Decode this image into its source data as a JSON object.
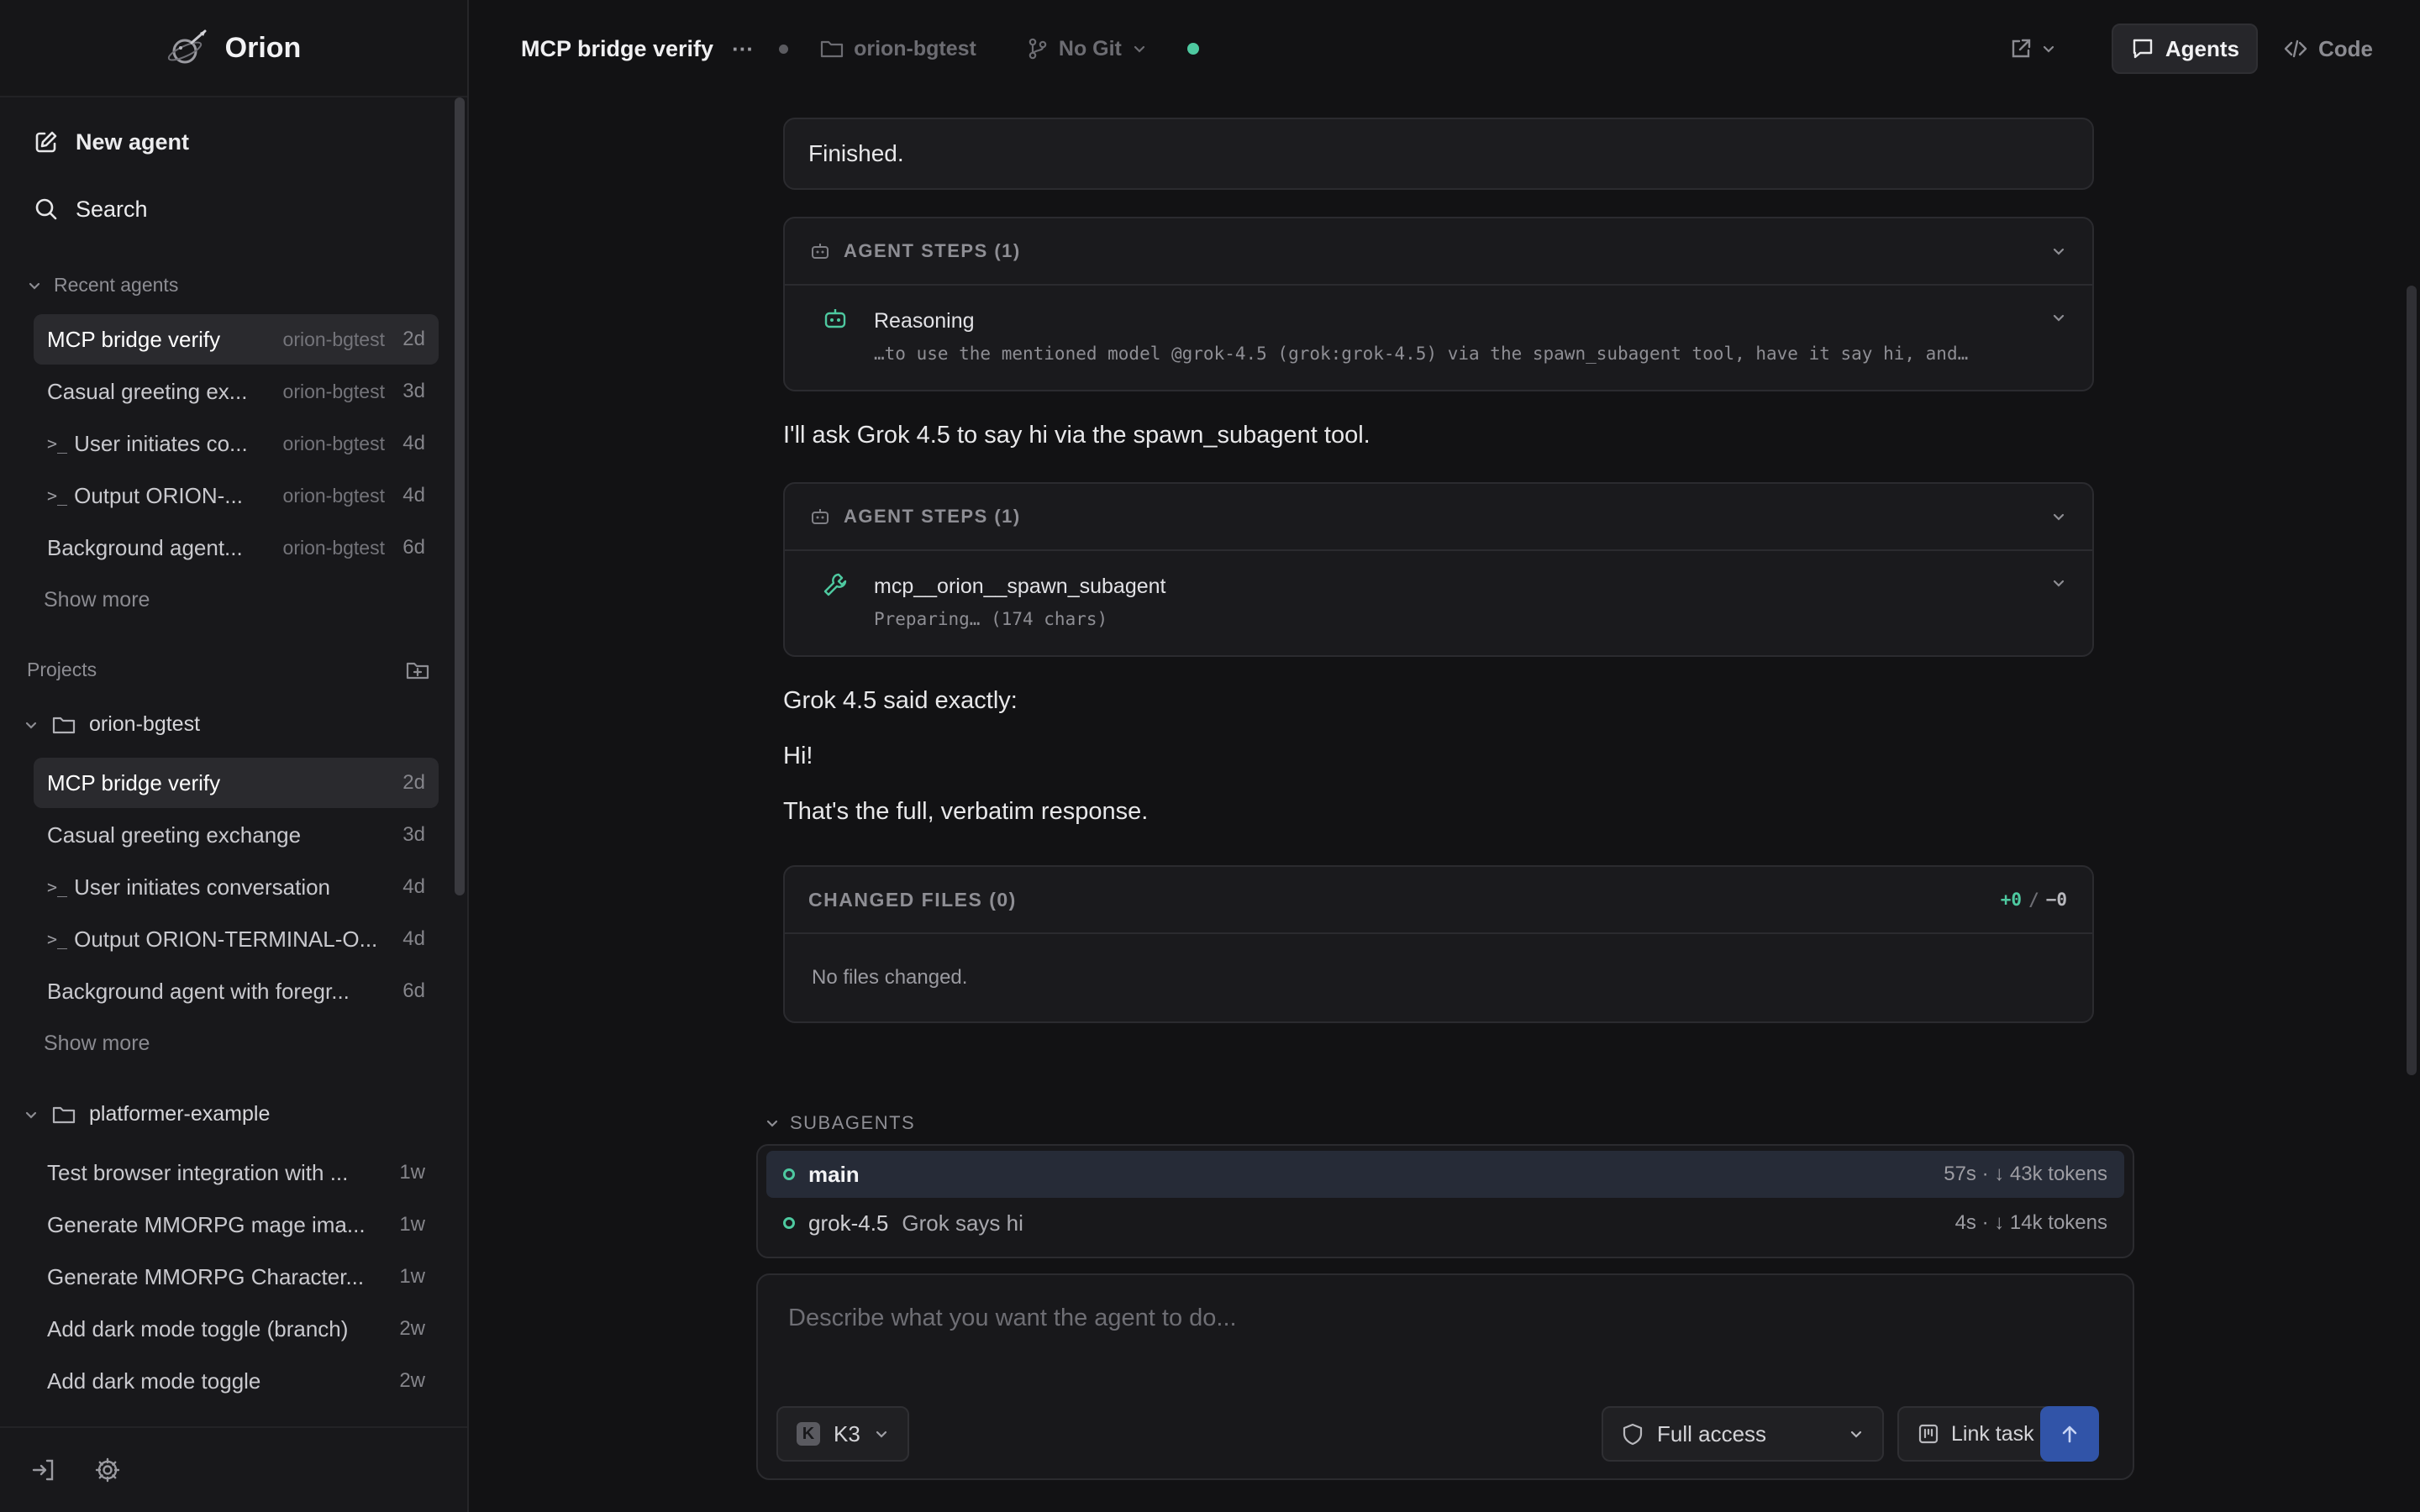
{
  "app": {
    "name": "Orion"
  },
  "sidebar": {
    "new_agent": "New agent",
    "search": "Search",
    "recent_heading": "Recent agents",
    "recent": [
      {
        "title": "MCP bridge verify",
        "project": "orion-bgtest",
        "age": "2d",
        "active": true,
        "terminal": false
      },
      {
        "title": "Casual greeting ex...",
        "project": "orion-bgtest",
        "age": "3d",
        "active": false,
        "terminal": false
      },
      {
        "title": "User initiates co...",
        "project": "orion-bgtest",
        "age": "4d",
        "active": false,
        "terminal": true
      },
      {
        "title": "Output ORION-...",
        "project": "orion-bgtest",
        "age": "4d",
        "active": false,
        "terminal": true
      },
      {
        "title": "Background agent...",
        "project": "orion-bgtest",
        "age": "6d",
        "active": false,
        "terminal": false
      }
    ],
    "show_more": "Show more",
    "projects_heading": "Projects",
    "projects": [
      {
        "name": "orion-bgtest",
        "items": [
          {
            "title": "MCP bridge verify",
            "age": "2d",
            "active": true,
            "terminal": false
          },
          {
            "title": "Casual greeting exchange",
            "age": "3d",
            "active": false,
            "terminal": false
          },
          {
            "title": "User initiates conversation",
            "age": "4d",
            "active": false,
            "terminal": true
          },
          {
            "title": "Output ORION-TERMINAL-O...",
            "age": "4d",
            "active": false,
            "terminal": true
          },
          {
            "title": "Background agent with foregr...",
            "age": "6d",
            "active": false,
            "terminal": false
          }
        ],
        "show_more": "Show more"
      },
      {
        "name": "platformer-example",
        "items": [
          {
            "title": "Test browser integration with ...",
            "age": "1w",
            "active": false,
            "terminal": false
          },
          {
            "title": "Generate MMORPG mage ima...",
            "age": "1w",
            "active": false,
            "terminal": false
          },
          {
            "title": "Generate MMORPG Character...",
            "age": "1w",
            "active": false,
            "terminal": false
          },
          {
            "title": "Add dark mode toggle (branch)",
            "age": "2w",
            "active": false,
            "terminal": false
          },
          {
            "title": "Add dark mode toggle",
            "age": "2w",
            "active": false,
            "terminal": false
          }
        ]
      }
    ]
  },
  "topbar": {
    "title": "MCP bridge verify",
    "more": "···",
    "project": "orion-bgtest",
    "git": "No Git",
    "tabs": {
      "agents": "Agents",
      "code": "Code"
    }
  },
  "chat": {
    "finished": "Finished.",
    "steps_1": {
      "heading": "AGENT STEPS (1)",
      "name": "Reasoning",
      "detail": "…to use the mentioned model @grok-4.5 (grok:grok-4.5) via the spawn_subagent tool, have it say hi, and…"
    },
    "msg_1": "I'll ask Grok 4.5 to say hi via the spawn_subagent tool.",
    "steps_2": {
      "heading": "AGENT STEPS (1)",
      "name": "mcp__orion__spawn_subagent",
      "detail": "Preparing… (174 chars)"
    },
    "msg_2": "Grok 4.5 said exactly:",
    "msg_3": "Hi!",
    "msg_4": "That's the full, verbatim response.",
    "changed_files": {
      "heading": "CHANGED FILES (0)",
      "plus": "+0",
      "slash": "/",
      "minus": "−0",
      "empty": "No files changed."
    }
  },
  "subagents": {
    "heading": "SUBAGENTS",
    "items": [
      {
        "name": "main",
        "desc": "",
        "stats": "57s · ↓ 43k tokens",
        "active": true
      },
      {
        "name": "grok-4.5",
        "desc": "Grok says hi",
        "stats": "4s · ↓ 14k tokens",
        "active": false
      }
    ]
  },
  "composer": {
    "placeholder": "Describe what you want the agent to do...",
    "model_badge": "K",
    "model": "K3",
    "access": "Full access",
    "link_task": "Link task"
  },
  "colors": {
    "accent_green": "#4ec9a0",
    "send_blue": "#3154a8"
  }
}
